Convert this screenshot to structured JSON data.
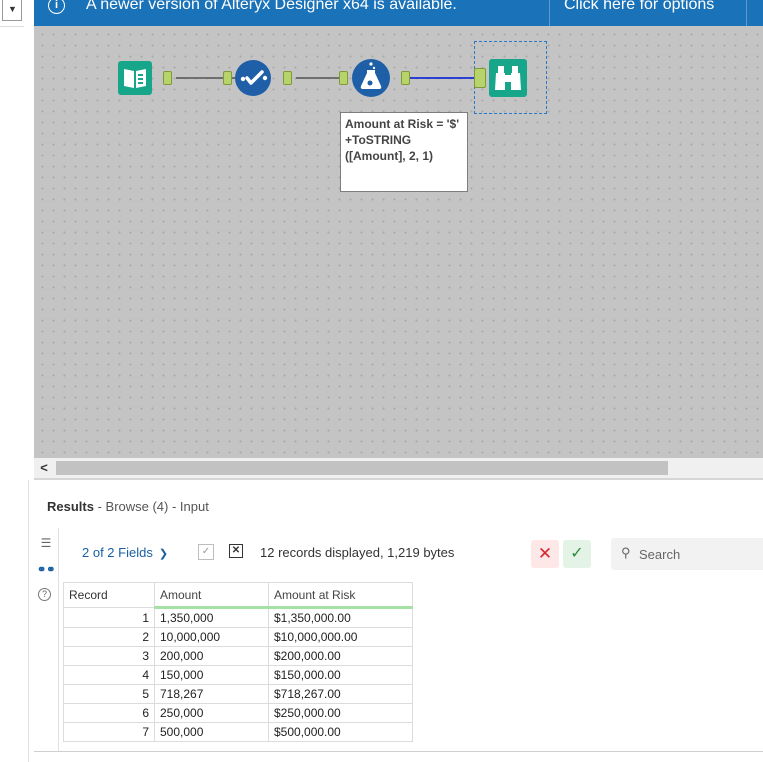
{
  "banner": {
    "info_icon": "i",
    "message": "A newer version of Alteryx Designer x64 is available.",
    "options_link": "Click here for options"
  },
  "canvas": {
    "tools": [
      {
        "name": "input-data-tool",
        "icon": "book-icon",
        "color": "#17a689"
      },
      {
        "name": "select-tool",
        "icon": "select-check-icon",
        "color": "#1f5fa8"
      },
      {
        "name": "formula-tool",
        "icon": "flask-icon",
        "color": "#1f5fa8"
      },
      {
        "name": "browse-tool",
        "icon": "binoculars-icon",
        "color": "#17a689"
      }
    ],
    "annotation": "Amount at Risk = '$' +ToSTRING\n([Amount], 2, 1)"
  },
  "scrollbar": {
    "left_arrow": "<"
  },
  "results": {
    "title_bold": "Results",
    "title_rest": " - Browse (4) - Input",
    "fields_label": "2 of 2 Fields",
    "records_text": "12 records displayed, 1,219 bytes",
    "search_placeholder": "Search",
    "columns": [
      "Record",
      "Amount",
      "Amount at Risk"
    ],
    "rows": [
      [
        "1",
        "1,350,000",
        "$1,350,000.00"
      ],
      [
        "2",
        "10,000,000",
        "$10,000,000.00"
      ],
      [
        "3",
        "200,000",
        "$200,000.00"
      ],
      [
        "4",
        "150,000",
        "$150,000.00"
      ],
      [
        "5",
        "718,267",
        "$718,267.00"
      ],
      [
        "6",
        "250,000",
        "$250,000.00"
      ],
      [
        "7",
        "500,000",
        "$500,000.00"
      ]
    ]
  },
  "colors": {
    "banner": "#1a72b8",
    "canvas": "#c4c4c4",
    "connection_selected": "#2b3fd0"
  }
}
